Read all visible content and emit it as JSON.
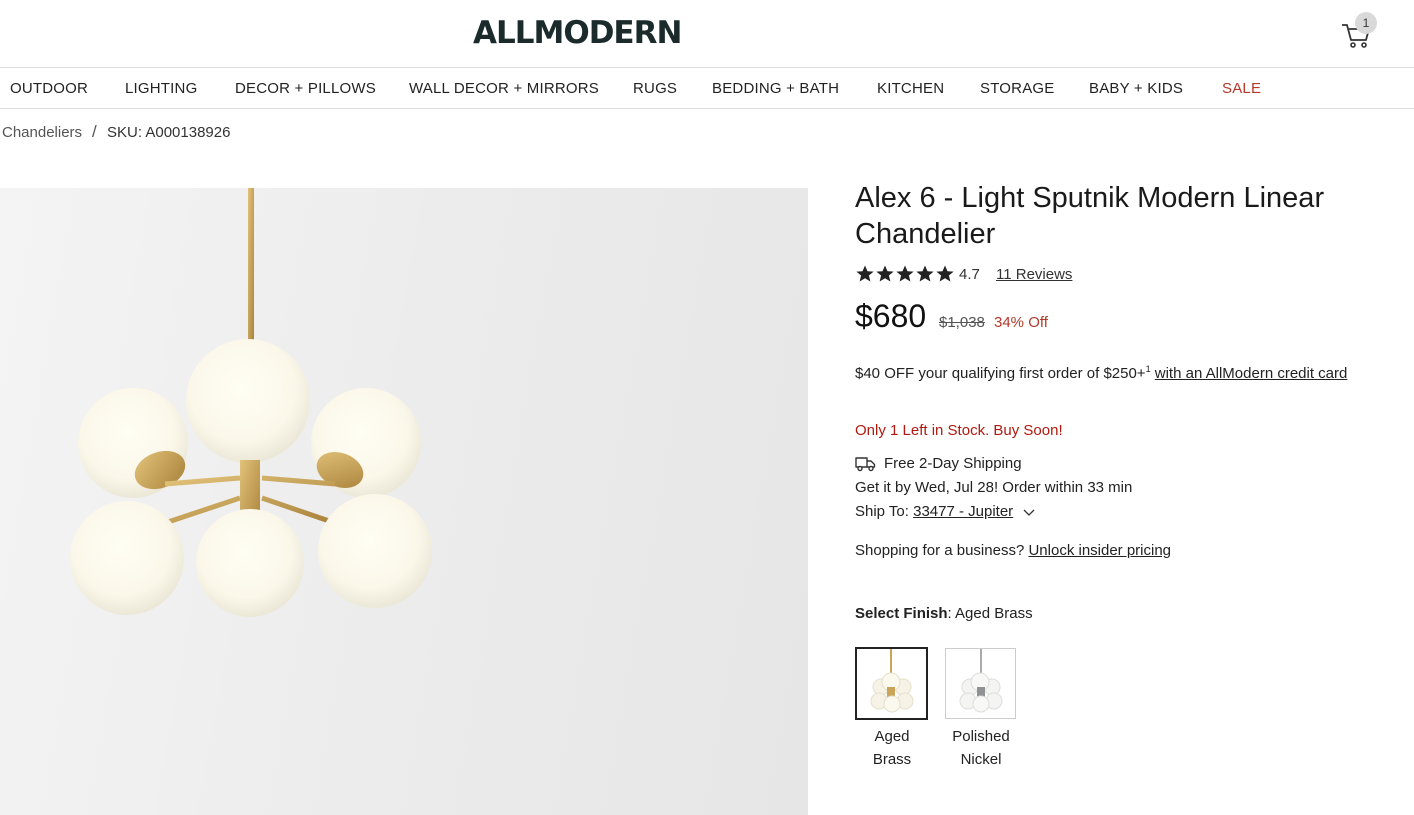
{
  "header": {
    "logo": "ALLMODERN",
    "cart_count": "1"
  },
  "nav": {
    "items": [
      "OUTDOOR",
      "LIGHTING",
      "DECOR + PILLOWS",
      "WALL DECOR + MIRRORS",
      "RUGS",
      "BEDDING + BATH",
      "KITCHEN",
      "STORAGE",
      "BABY + KIDS",
      "SALE"
    ]
  },
  "breadcrumb": {
    "category": "Chandeliers",
    "separator": "/",
    "sku": "SKU: A000138926"
  },
  "product": {
    "title": "Alex 6 - Light Sputnik Modern Linear Chandelier",
    "rating": "4.7",
    "rating_value": 4.7,
    "rating_max": 5,
    "reviews": "11 Reviews",
    "price": "$680",
    "old_price": "$1,038",
    "discount": "34% Off",
    "promo_text": "$40 OFF your qualifying first order of $250+",
    "promo_sup": "1",
    "promo_link": "with an AllModern credit card",
    "stock_message": "Only 1 Left in Stock. Buy Soon!",
    "shipping": "Free 2-Day Shipping",
    "delivery": "Get it by Wed, Jul 28! Order within 33 min",
    "ship_to_label": "Ship To:",
    "ship_to_zip": "33477 - Jupiter",
    "business_text": "Shopping for a business?",
    "business_link": "Unlock insider pricing",
    "finish_label": "Select Finish",
    "finish_selected": ": Aged Brass",
    "finishes": [
      {
        "line1": "Aged",
        "line2": "Brass"
      },
      {
        "line1": "Polished",
        "line2": "Nickel"
      }
    ]
  },
  "colors": {
    "sale_red": "#b23a2a",
    "stock_red": "#b2190f",
    "brass": "#c9a55a"
  },
  "icons": {
    "cart": "cart-icon",
    "star": "star-icon",
    "truck": "truck-icon",
    "chevron": "chevron-down-icon"
  }
}
